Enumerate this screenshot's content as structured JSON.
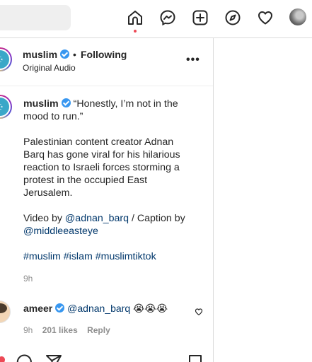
{
  "nav": {
    "search_placeholder": "",
    "icons": [
      "home-icon",
      "messenger-icon",
      "create-icon",
      "explore-icon",
      "activity-heart-icon",
      "profile-avatar"
    ]
  },
  "post": {
    "username": "muslim",
    "dot": "•",
    "follow_label": "Following",
    "audio_label": "Original Audio",
    "more_label": "•••"
  },
  "caption": {
    "username": "muslim",
    "quote": "“Honestly, I’m not in the mood to run.”",
    "paragraph": "Palestinian content creator Adnan Barq has gone viral for his hilarious reaction to Israeli forces storming a protest in the occupied East Jerusalem.",
    "credit_prefix": "Video by ",
    "credit_user1": "@adnan_barq",
    "credit_middle": " / Caption by ",
    "credit_user2": "@middleeasteye",
    "hashtags": [
      "#muslim",
      "#islam",
      "#muslimtiktok"
    ],
    "time": "9h"
  },
  "comment": {
    "username": "ameer",
    "mention": "@adnan_barq",
    "emoji": "😭😭😭",
    "time": "9h",
    "likes": "201 likes",
    "reply_label": "Reply"
  },
  "colors": {
    "link": "#00376b",
    "verified": "#3897f0",
    "notification_dot": "#ed4956",
    "muted": "#8e8e8e"
  }
}
